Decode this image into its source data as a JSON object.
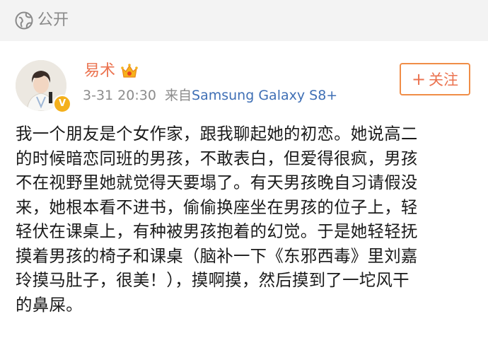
{
  "visibility": {
    "icon": "globe-icon",
    "label": "公开"
  },
  "post": {
    "author": "易术",
    "author_badge": "crown-vip-icon",
    "verified_badge": "V",
    "time": "3-31 20:30",
    "source_prefix": "来自",
    "source_device": "Samsung Galaxy S8+",
    "follow_label": "关注",
    "follow_icon": "plus-icon",
    "lines": [
      "我一个朋友是个女作家，跟我聊起她的初恋。她说高二",
      "的时候暗恋同班的男孩，不敢表白，但爱得很疯，男孩",
      "不在视野里她就觉得天要塌了。有天男孩晚自习请假没",
      "来，她根本看不进书，偷偷换座坐在男孩的位子上，轻",
      "轻伏在课桌上，有种被男孩抱着的幻觉。于是她轻轻抚",
      "摸着男孩的椅子和课桌（脑补一下《东邪西毒》里刘嘉",
      "玲摸马肚子，很美！），摸啊摸，然后摸到了一坨风干",
      "的鼻屎。"
    ]
  },
  "colors": {
    "accent": "#eb7350",
    "link": "#3f6fb5",
    "meta": "#8c8c8c",
    "topbar_bg": "#f3f3f3"
  }
}
